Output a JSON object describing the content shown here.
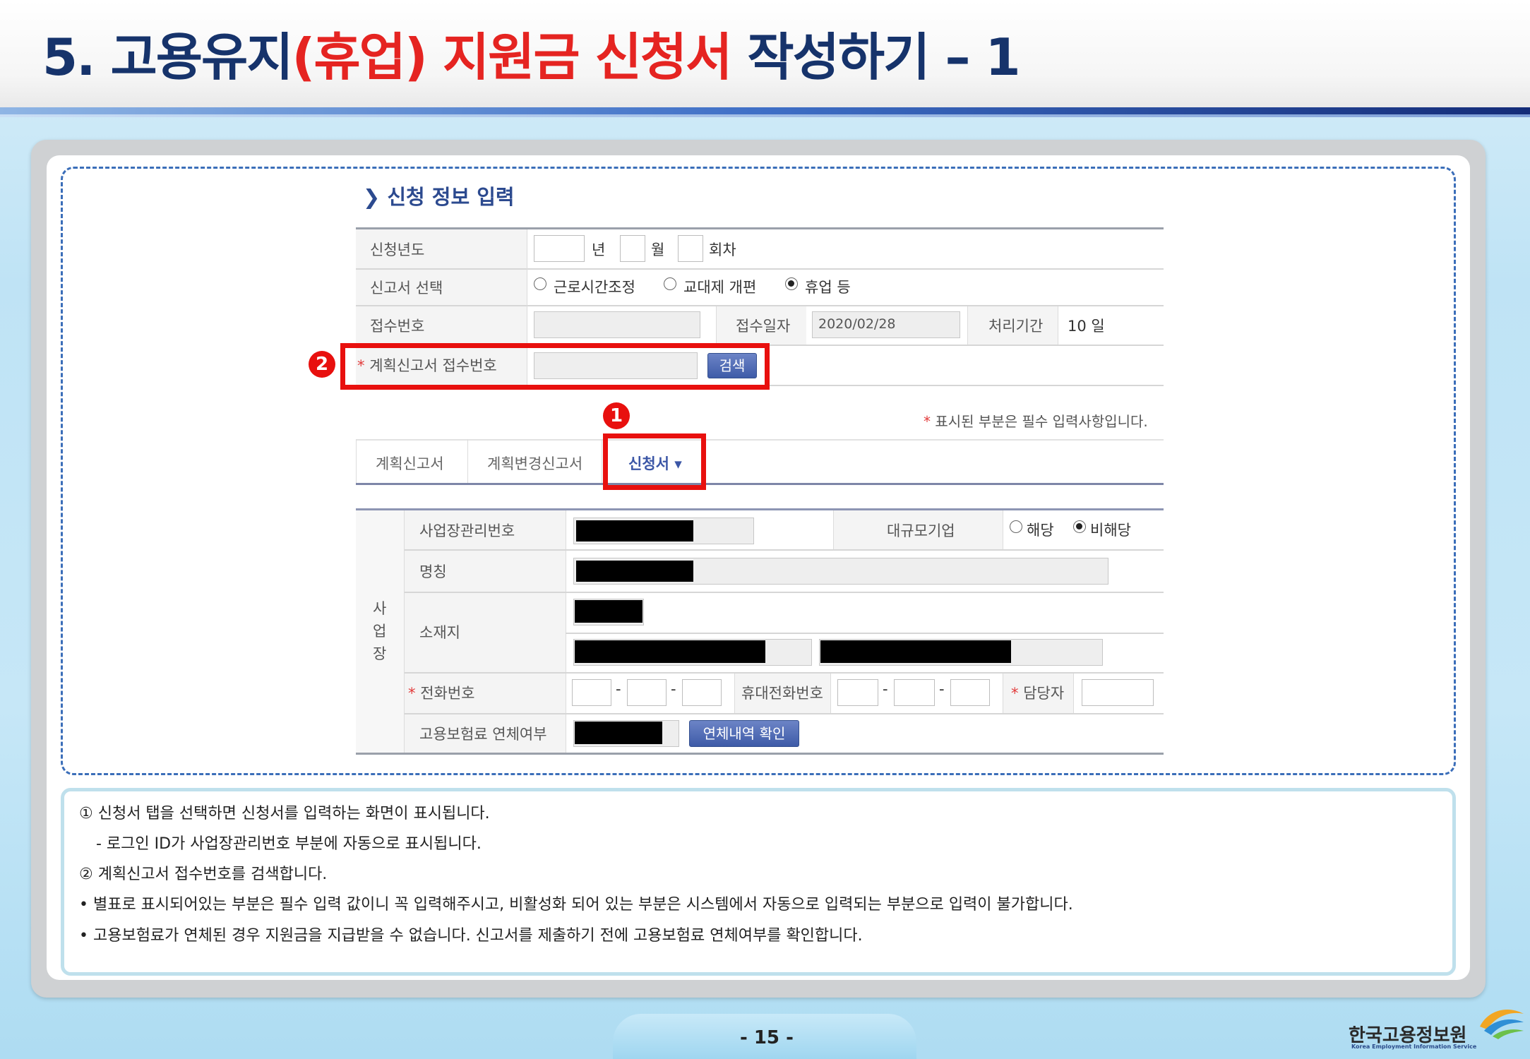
{
  "slide": {
    "title_part1": "5. 고용유지",
    "title_part2": "(휴업) 지원금 신청서",
    "title_part3": " 작성하기 – 1",
    "page_number": "- 15 -",
    "logo_name": "한국고용정보원",
    "logo_sub": "Korea Employment Information Service"
  },
  "form": {
    "section_title": "신청 정보 입력",
    "labels": {
      "apply_year": "신청년도",
      "year_unit": "년",
      "month_unit": "월",
      "round_unit": "회차",
      "report_select": "신고서 선택",
      "receipt_no": "접수번호",
      "receipt_date": "접수일자",
      "process_period": "처리기간",
      "plan_receipt_no": "계획신고서 접수번호",
      "required_note": "표시된 부분은 필수 입력사항입니다.",
      "star": "*"
    },
    "report_options": [
      "근로시간조정",
      "교대제 개편",
      "휴업 등"
    ],
    "selected_report": "휴업 등",
    "receipt_date_value": "2020/02/28",
    "process_period_value": "10 일",
    "search_button": "검색",
    "tabs": [
      "계획신고서",
      "계획변경신고서",
      "신청서"
    ],
    "active_tab": "신청서",
    "tab_caret": "▾"
  },
  "workplace": {
    "side_label": [
      "사",
      "업",
      "장"
    ],
    "mgmt_no": "사업장관리번호",
    "large_company": "대규모기업",
    "large_options": [
      "해당",
      "비해당"
    ],
    "large_selected": "비해당",
    "name": "명칭",
    "address": "소재지",
    "phone": "전화번호",
    "mobile": "휴대전화번호",
    "manager": "담당자",
    "dash": "-",
    "insurance_arrears": "고용보험료 연체여부",
    "arrears_button": "연체내역 확인"
  },
  "annotations": {
    "badge1": "1",
    "badge2": "2"
  },
  "notes": [
    "① 신청서 탭을 선택하면 신청서를 입력하는 화면이 표시됩니다.",
    "- 로그인 ID가 사업장관리번호 부분에 자동으로 표시됩니다.",
    "② 계획신고서 접수번호를 검색합니다.",
    "•    별표로 표시되어있는 부분은 필수 입력 값이니 꼭 입력해주시고, 비활성화 되어 있는 부분은 시스템에서 자동으로 입력되는 부분으로 입력이 불가합니다.",
    "•    고용보험료가 연체된 경우 지원금을 지급받을 수 없습니다. 신고서를 제출하기 전에 고용보험료 연체여부를 확인합니다."
  ]
}
